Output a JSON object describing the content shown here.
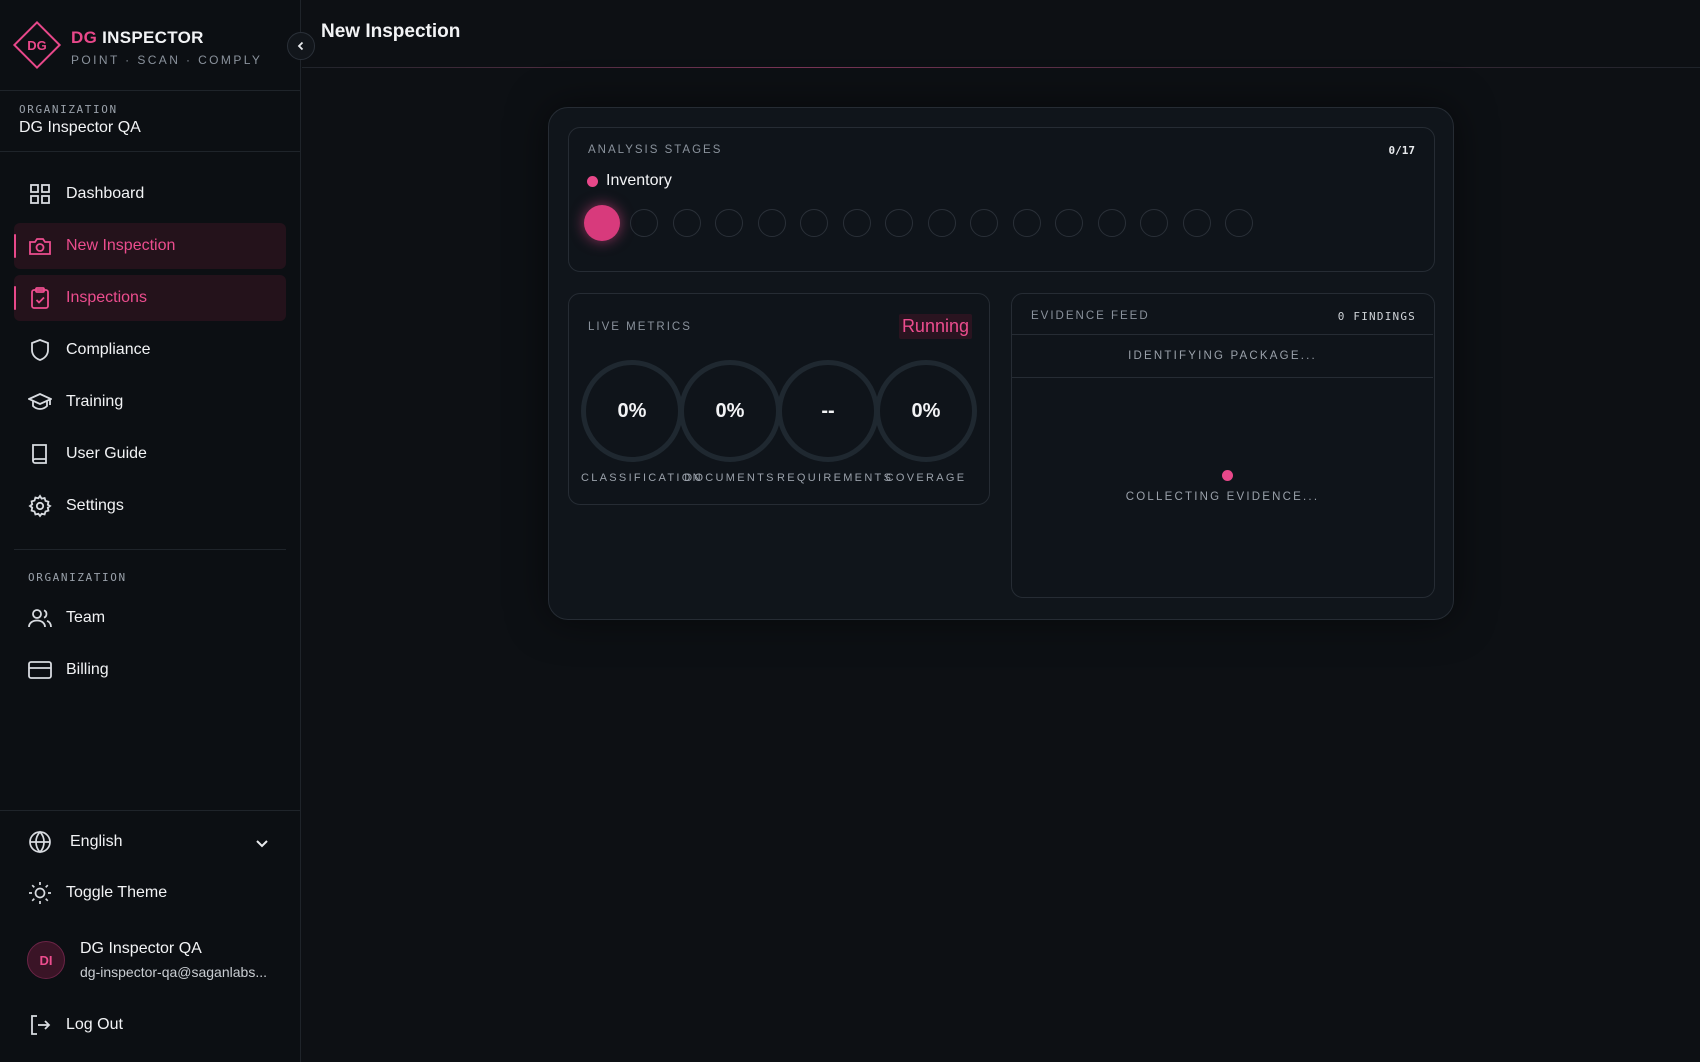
{
  "app": {
    "brand_prefix": "DG",
    "brand_name": "INSPECTOR",
    "logo_text": "DG",
    "tagline": "POINT · SCAN · COMPLY"
  },
  "sidebar": {
    "org_label": "ORGANIZATION",
    "org_name": "DG Inspector QA",
    "nav": [
      {
        "label": "Dashboard",
        "icon": "grid-icon",
        "active": false
      },
      {
        "label": "New Inspection",
        "icon": "camera-icon",
        "active": true
      },
      {
        "label": "Inspections",
        "icon": "clipboard-check-icon",
        "active": true
      },
      {
        "label": "Compliance",
        "icon": "shield-icon",
        "active": false
      },
      {
        "label": "Training",
        "icon": "graduation-cap-icon",
        "active": false
      },
      {
        "label": "User Guide",
        "icon": "book-icon",
        "active": false
      },
      {
        "label": "Settings",
        "icon": "gear-icon",
        "active": false
      }
    ],
    "section_label": "ORGANIZATION",
    "org_nav": [
      {
        "label": "Team",
        "icon": "users-icon"
      },
      {
        "label": "Billing",
        "icon": "credit-card-icon"
      }
    ],
    "language": "English",
    "toggle_theme": "Toggle Theme",
    "user": {
      "initials": "DI",
      "name": "DG Inspector QA",
      "email": "dg-inspector-qa@saganlabs..."
    },
    "logout": "Log Out"
  },
  "header": {
    "title": "New Inspection"
  },
  "analysis": {
    "title": "ANALYSIS STAGES",
    "count": "0/17",
    "current_stage": "Inventory",
    "stages_total": 17,
    "stages_completed": 0
  },
  "metrics": {
    "title": "LIVE METRICS",
    "status": "Running",
    "items": [
      {
        "value": "0%",
        "label": "CLASSIFICATION"
      },
      {
        "value": "0%",
        "label": "DOCUMENTS"
      },
      {
        "value": "--",
        "label": "REQUIREMENTS"
      },
      {
        "value": "0%",
        "label": "COVERAGE"
      }
    ]
  },
  "evidence": {
    "title": "EVIDENCE FEED",
    "findings": "0 FINDINGS",
    "status": "IDENTIFYING PACKAGE...",
    "empty": "COLLECTING EVIDENCE..."
  },
  "colors": {
    "accent": "#e8488a",
    "background": "#0d1014",
    "panel": "#10151b"
  }
}
